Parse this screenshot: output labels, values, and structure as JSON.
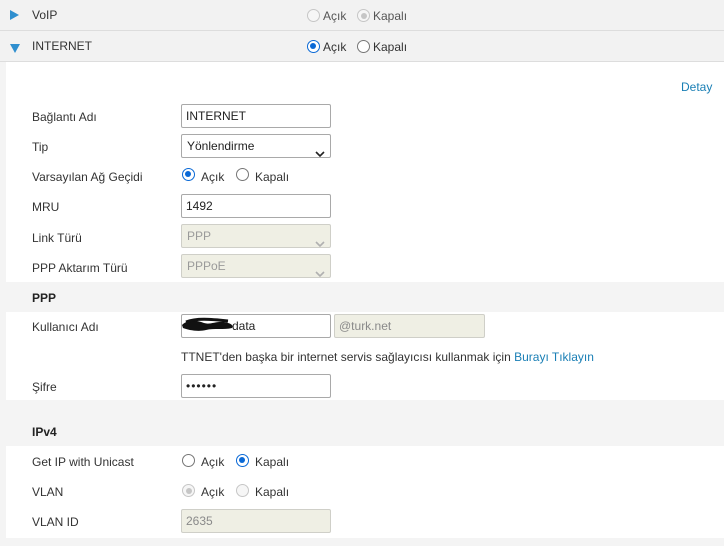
{
  "voip": {
    "title": "VoIP",
    "options": [
      "Açık",
      "Kapalı"
    ],
    "selected": "Kapalı"
  },
  "internet": {
    "title": "INTERNET",
    "options": [
      "Açık",
      "Kapalı"
    ],
    "selected": "Açık"
  },
  "detail_link": "Detay",
  "fields": {
    "connection_name": {
      "label": "Bağlantı Adı",
      "value": "INTERNET"
    },
    "type": {
      "label": "Tip",
      "value": "Yönlendirme"
    },
    "default_gateway": {
      "label": "Varsayılan Ağ Geçidi",
      "options": [
        "Açık",
        "Kapalı"
      ],
      "selected": "Açık"
    },
    "mru": {
      "label": "MRU",
      "value": "1492"
    },
    "link_type": {
      "label": "Link Türü",
      "value": "PPP"
    },
    "ppp_transport": {
      "label": "PPP Aktarım Türü",
      "value": "PPPoE"
    }
  },
  "ppp": {
    "section_title": "PPP",
    "username": {
      "label": "Kullanıcı Adı",
      "value_visible": "data",
      "domain": "@turk.net"
    },
    "isp_note": {
      "text": "TTNET'den başka bir internet servis sağlayıcısı kullanmak için",
      "link": "Burayı Tıklayın"
    },
    "password": {
      "label": "Şifre",
      "value": "••••••"
    }
  },
  "ipv4": {
    "section_title": "IPv4",
    "unicast": {
      "label": "Get IP with Unicast",
      "options": [
        "Açık",
        "Kapalı"
      ],
      "selected": "Kapalı"
    },
    "vlan": {
      "label": "VLAN",
      "options": [
        "Açık",
        "Kapalı"
      ],
      "selected": "Açık",
      "disabled": true
    },
    "vlan_id": {
      "label": "VLAN ID",
      "value": "2635"
    }
  },
  "colors": {
    "accent": "#1a7fb5",
    "radio": "#0a69d6",
    "header_bg": "#f2f2f2"
  }
}
